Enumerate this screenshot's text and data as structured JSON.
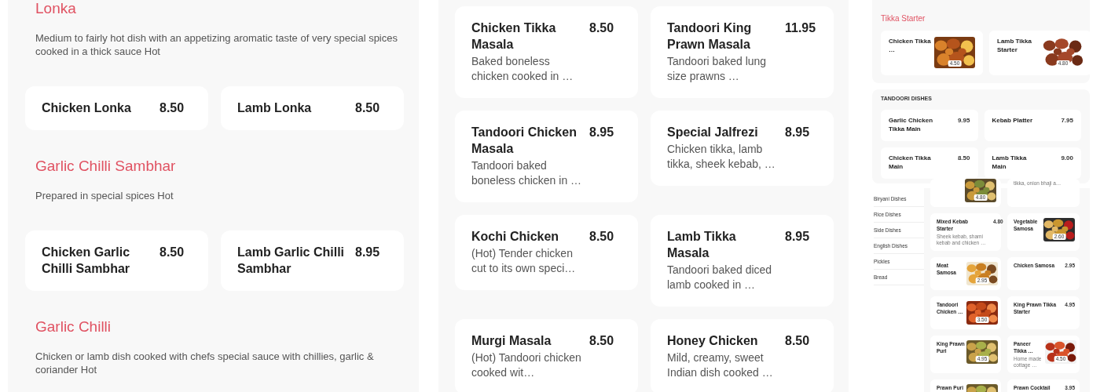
{
  "left_menu": {
    "sections": [
      {
        "title": "Lonka",
        "description": "Medium to fairly hot dish with an appetizing aromatic taste of very special spices cooked in a thick sauce Hot",
        "items": [
          {
            "name": "Chicken Lonka",
            "price": "8.50"
          },
          {
            "name": "Lamb Lonka",
            "price": "8.50"
          }
        ]
      },
      {
        "title": "Garlic Chilli Sambhar",
        "description": "Prepared in special spices Hot",
        "items": [
          {
            "name": "Chicken Garlic Chilli Sambhar",
            "price": "8.50"
          },
          {
            "name": "Lamb Garlic Chilli Sambhar",
            "price": "8.95"
          }
        ]
      },
      {
        "title": "Garlic Chilli",
        "description": "Chicken or lamb dish cooked with chefs special sauce with chillies, garlic & coriander Hot"
      }
    ]
  },
  "middle_menu": {
    "items": [
      {
        "name": "Chicken Tikka Masala",
        "price": "8.50",
        "description": "Baked boneless chicken cooked in …"
      },
      {
        "name": "Tandoori King Prawn Masala",
        "price": "11.95",
        "description": "Tandoori baked lung size prawns …"
      },
      {
        "name": "Tandoori Chicken Masala",
        "price": "8.95",
        "description": "Tandoori baked boneless chicken in …"
      },
      {
        "name": "Special Jalfrezi",
        "price": "8.95",
        "description": "Chicken tikka, lamb tikka, sheek kebab, …"
      },
      {
        "name": "Kochi Chicken",
        "price": "8.50",
        "description": "(Hot) Tender chicken cut to its own speci…"
      },
      {
        "name": "Lamb Tikka Masala",
        "price": "8.95",
        "description": "Tandoori baked diced lamb cooked in …"
      },
      {
        "name": "Murgi Masala",
        "price": "8.50",
        "description": "(Hot) Tandoori chicken cooked wit…"
      },
      {
        "name": "Honey Chicken",
        "price": "8.50",
        "description": "Mild, creamy, sweet Indian dish cooked …"
      }
    ]
  },
  "right_menu": {
    "sections": [
      {
        "title": "Tikka Starter",
        "kind": "accent",
        "items": [
          {
            "name": "Chicken Tikka …",
            "price": "4.50"
          },
          {
            "name": "Lamb Tikka Starter",
            "price": "4.80"
          }
        ]
      },
      {
        "title": "TANDOORI DISHES",
        "kind": "caps",
        "items": [
          {
            "kind": "plain",
            "name": "Garlic Chicken Tikka Main",
            "price": "9.95"
          },
          {
            "kind": "plain",
            "name": "Kebab Platter",
            "price": "7.95"
          },
          {
            "kind": "plain",
            "name": "Chicken Tikka Main",
            "price": "8.50"
          },
          {
            "kind": "plain",
            "name": "Lamb Tikka Main",
            "price": "9.00"
          }
        ]
      }
    ],
    "sidebar": {
      "items": [
        {
          "label": "Biryani Dishes"
        },
        {
          "label": "Rice Dishes"
        },
        {
          "label": "Side Dishes"
        },
        {
          "label": "English Dishes"
        },
        {
          "label": "Pickles"
        },
        {
          "label": "Bread"
        }
      ]
    },
    "grid": [
      {
        "price": "4.80"
      },
      {
        "kind": "plain",
        "description": "tikka, onion bhaji a…"
      },
      {
        "kind": "plain",
        "name": "Mixed Kebab Starter",
        "price": "4.80",
        "description": "Sheek kebab, shami kebab and chicken …"
      },
      {
        "name": "Vegetable Samosa",
        "price": "2.60"
      },
      {
        "name": "Meat Samosa",
        "price": "2.95"
      },
      {
        "kind": "plain",
        "name": "Chicken Samosa",
        "price": "2.95"
      },
      {
        "name": "Tandoori Chicken …",
        "price": "3.50"
      },
      {
        "kind": "plain",
        "name": "King Prawn Tikka Starter",
        "price": "4.95"
      },
      {
        "name": "King Prawn Puri",
        "price": "4.95"
      },
      {
        "name": "Paneer Tikka …",
        "price": "4.50",
        "description": "Home made cottage …"
      },
      {
        "name": "Prawn Puri"
      },
      {
        "kind": "plain",
        "name": "Prawn Cocktail",
        "price": "3.95"
      }
    ]
  }
}
